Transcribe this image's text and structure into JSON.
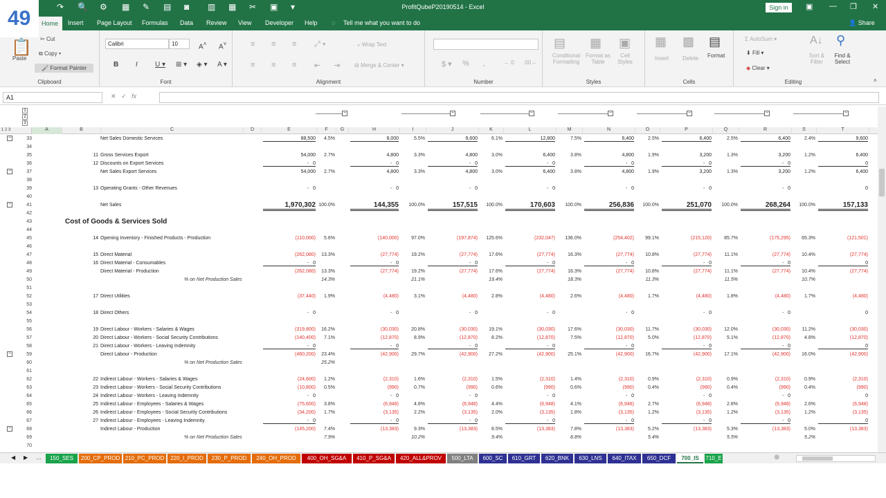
{
  "badge": "49",
  "app": {
    "title": "ProfitQubeP20190514  -  Excel",
    "signin": "Sign in"
  },
  "tabs": [
    {
      "label": "Home"
    },
    {
      "label": "Insert"
    },
    {
      "label": "Page Layout"
    },
    {
      "label": "Formulas"
    },
    {
      "label": "Data"
    },
    {
      "label": "Review"
    },
    {
      "label": "View"
    },
    {
      "label": "Developer"
    },
    {
      "label": "Help"
    },
    {
      "label": "Tell me what you want to do"
    }
  ],
  "share": "Share",
  "ribbon": {
    "clipboard": {
      "paste": "Paste",
      "cut": "Cut",
      "copy": "Copy",
      "painter": "Format Painter",
      "label": "Clipboard"
    },
    "font": {
      "name": "Calibri",
      "size": "10",
      "label": "Font"
    },
    "alignment": {
      "wrap": "Wrap Text",
      "merge": "Merge & Center",
      "label": "Alignment"
    },
    "number": {
      "label": "Number"
    },
    "styles": {
      "cond": "Conditional Formatting",
      "astable": "Format as Table",
      "cell": "Cell Styles",
      "label": "Styles"
    },
    "cells": {
      "insert": "Insert",
      "delete": "Delete",
      "format": "Format",
      "label": "Cells"
    },
    "editing": {
      "autosum": "AutoSum",
      "fill": "Fill",
      "clear": "Clear",
      "sort": "Sort & Filter",
      "find": "Find & Select",
      "label": "Editing"
    }
  },
  "namebox": "A1",
  "fx": "fx",
  "columns": [
    "A",
    "B",
    "C",
    "D",
    "E",
    "F",
    "G",
    "H",
    "I",
    "J",
    "K",
    "L",
    "M",
    "N",
    "O",
    "P",
    "Q",
    "R",
    "S",
    "T"
  ],
  "rows": [
    {
      "n": "33",
      "label": "Net Sales Domestic Services",
      "v": [
        "88,500",
        "8,000",
        "9,600",
        "12,800",
        "6,400",
        "6,400",
        "6,400",
        "9,600"
      ],
      "p": [
        "4.5%",
        "5.5%",
        "6.1%",
        "7.5%",
        "2.5%",
        "2.5%",
        "2.4%"
      ],
      "ul": true
    },
    {
      "n": "34"
    },
    {
      "n": "35",
      "num": "11",
      "label": "Gross Services Export",
      "v": [
        "54,000",
        "4,800",
        "4,800",
        "6,400",
        "4,800",
        "3,200",
        "3,200",
        "6,400"
      ],
      "p": [
        "2.7%",
        "3.3%",
        "3.0%",
        "3.8%",
        "1.9%",
        "1.3%",
        "1.2%"
      ]
    },
    {
      "n": "36",
      "num": "12",
      "label": "Discounts on Export Services",
      "v": [
        "0",
        "0",
        "0",
        "0",
        "0",
        "0",
        "0",
        "0"
      ],
      "p": [
        "-",
        "-",
        "-",
        "-",
        "-",
        "-",
        "-"
      ],
      "ul": true
    },
    {
      "n": "37",
      "label": "Net Sales Export Services",
      "v": [
        "54,000",
        "4,800",
        "4,800",
        "6,400",
        "4,800",
        "3,200",
        "3,200",
        "6,400"
      ],
      "p": [
        "2.7%",
        "3.3%",
        "3.0%",
        "3.8%",
        "1.9%",
        "1.3%",
        "1.2%"
      ]
    },
    {
      "n": "38"
    },
    {
      "n": "39",
      "num": "13",
      "label": "Operating Grants - Other Revenues",
      "v": [
        "0",
        "0",
        "0",
        "0",
        "0",
        "0",
        "0",
        "0"
      ],
      "p": [
        "-",
        "-",
        "-",
        "-",
        "-",
        "-",
        "-"
      ]
    },
    {
      "n": "40"
    },
    {
      "n": "41",
      "label": "Net Sales",
      "v": [
        "1,970,302",
        "144,355",
        "157,515",
        "170,603",
        "256,836",
        "251,070",
        "268,264",
        "157,133"
      ],
      "p": [
        "100.0%",
        "100.0%",
        "100.0%",
        "100.0%",
        "100.0%",
        "100.0%",
        "100.0%"
      ],
      "total": true
    },
    {
      "n": "42"
    },
    {
      "n": "43",
      "section": "Cost of Goods & Services Sold"
    },
    {
      "n": "44"
    },
    {
      "n": "45",
      "num": "14",
      "label": "Opening Inventory - Finished Products - Production",
      "v": [
        "(110,000)",
        "(140,000)",
        "(197,874)",
        "(232,047)",
        "(254,402)",
        "(215,120)",
        "(175,295)",
        "(121,501)"
      ],
      "p": [
        "5.6%",
        "97.0%",
        "125.6%",
        "136.0%",
        "99.1%",
        "85.7%",
        "65.3%"
      ],
      "neg": true
    },
    {
      "n": "46"
    },
    {
      "n": "47",
      "num": "15",
      "label": "Direct Material",
      "v": [
        "(262,080)",
        "(27,774)",
        "(27,774)",
        "(27,774)",
        "(27,774)",
        "(27,774)",
        "(27,774)",
        "(27,774)"
      ],
      "p": [
        "13.3%",
        "19.2%",
        "17.6%",
        "16.3%",
        "10.8%",
        "11.1%",
        "10.4%"
      ],
      "neg": true
    },
    {
      "n": "48",
      "num": "16",
      "label": "Direct Material - Consumables",
      "v": [
        "0",
        "0",
        "0",
        "0",
        "0",
        "0",
        "0",
        "0"
      ],
      "p": [
        "-",
        "-",
        "-",
        "-",
        "-",
        "-",
        "-"
      ],
      "neg": true,
      "ul": true
    },
    {
      "n": "49",
      "label": "Direct Material - Production",
      "v": [
        "(262,080)",
        "(27,774)",
        "(27,774)",
        "(27,774)",
        "(27,774)",
        "(27,774)",
        "(27,774)",
        "(27,774)"
      ],
      "p": [
        "13.3%",
        "19.2%",
        "17.6%",
        "16.3%",
        "10.8%",
        "11.1%",
        "10.4%"
      ],
      "neg": true
    },
    {
      "n": "50",
      "note": "% on Net Production Sales",
      "ip": [
        "14.3%",
        "21.1%",
        "19.4%",
        "18.3%",
        "11.3%",
        "11.5%",
        "10.7%"
      ]
    },
    {
      "n": "51"
    },
    {
      "n": "52",
      "num": "17",
      "label": "Direct Utilities",
      "v": [
        "(37,440)",
        "(4,480)",
        "(4,480)",
        "(4,480)",
        "(4,480)",
        "(4,480)",
        "(4,480)",
        "(4,480)"
      ],
      "p": [
        "1.9%",
        "3.1%",
        "2.8%",
        "2.6%",
        "1.7%",
        "1.8%",
        "1.7%"
      ],
      "neg": true
    },
    {
      "n": "53"
    },
    {
      "n": "54",
      "num": "18",
      "label": "Direct Others",
      "v": [
        "0",
        "0",
        "0",
        "0",
        "0",
        "0",
        "0",
        "0"
      ],
      "p": [
        "-",
        "-",
        "-",
        "-",
        "-",
        "-",
        "-"
      ],
      "neg": true
    },
    {
      "n": "55"
    },
    {
      "n": "56",
      "num": "19",
      "label": "Direct Labour - Workers - Salaries & Wages",
      "v": [
        "(319,800)",
        "(30,030)",
        "(30,030)",
        "(30,030)",
        "(30,030)",
        "(30,030)",
        "(30,030)",
        "(30,030)"
      ],
      "p": [
        "16.2%",
        "20.8%",
        "19.1%",
        "17.6%",
        "11.7%",
        "12.0%",
        "11.2%"
      ],
      "neg": true
    },
    {
      "n": "57",
      "num": "20",
      "label": "Direct Labour - Workers - Social Security Contributions",
      "v": [
        "(140,400)",
        "(12,870)",
        "(12,870)",
        "(12,870)",
        "(12,870)",
        "(12,870)",
        "(12,870)",
        "(12,870)"
      ],
      "p": [
        "7.1%",
        "8.9%",
        "8.2%",
        "7.5%",
        "5.0%",
        "5.1%",
        "4.8%"
      ],
      "neg": true
    },
    {
      "n": "58",
      "num": "21",
      "label": "Direct Labour - Workers - Leaving Indemnity",
      "v": [
        "0",
        "0",
        "0",
        "0",
        "0",
        "0",
        "0",
        "0"
      ],
      "p": [
        "-",
        "-",
        "-",
        "-",
        "-",
        "-",
        "-"
      ],
      "neg": true,
      "ul": true
    },
    {
      "n": "59",
      "label": "Direct Labour - Production",
      "v": [
        "(460,200)",
        "(42,900)",
        "(42,900)",
        "(42,900)",
        "(42,900)",
        "(42,900)",
        "(42,900)",
        "(42,900)"
      ],
      "p": [
        "23.4%",
        "29.7%",
        "27.2%",
        "25.1%",
        "16.7%",
        "17.1%",
        "16.0%"
      ],
      "neg": true
    },
    {
      "n": "60",
      "note": "% on Net Production Sales",
      "ip": [
        "25.2%",
        "",
        "",
        "",
        "",
        "",
        ""
      ]
    },
    {
      "n": "61"
    },
    {
      "n": "62",
      "num": "22",
      "label": "Indirect Labour - Workers - Salaries & Wages",
      "v": [
        "(24,600)",
        "(2,310)",
        "(2,310)",
        "(2,310)",
        "(2,310)",
        "(2,310)",
        "(2,310)",
        "(2,310)"
      ],
      "p": [
        "1.2%",
        "1.6%",
        "1.5%",
        "1.4%",
        "0.9%",
        "0.9%",
        "0.9%"
      ],
      "neg": true
    },
    {
      "n": "63",
      "num": "23",
      "label": "Indirect Labour - Workers - Social Security Contributions",
      "v": [
        "(10,800)",
        "(990)",
        "(990)",
        "(990)",
        "(990)",
        "(990)",
        "(990)",
        "(990)"
      ],
      "p": [
        "0.5%",
        "0.7%",
        "0.6%",
        "0.6%",
        "0.4%",
        "0.4%",
        "0.4%"
      ],
      "neg": true
    },
    {
      "n": "64",
      "num": "24",
      "label": "Indirect Labour - Workers - Leaving Indemnity",
      "v": [
        "0",
        "0",
        "0",
        "0",
        "0",
        "0",
        "0",
        "0"
      ],
      "p": [
        "-",
        "-",
        "-",
        "-",
        "-",
        "-",
        "-"
      ],
      "neg": true
    },
    {
      "n": "65",
      "num": "25",
      "label": "Indirect Labour - Employees - Salaries & Wages",
      "v": [
        "(75,600)",
        "(6,948)",
        "(6,948)",
        "(6,948)",
        "(6,948)",
        "(6,948)",
        "(6,948)",
        "(6,948)"
      ],
      "p": [
        "3.8%",
        "4.8%",
        "4.4%",
        "4.1%",
        "2.7%",
        "2.8%",
        "2.6%"
      ],
      "neg": true
    },
    {
      "n": "66",
      "num": "26",
      "label": "Indirect Labour - Employees - Social Security Contributions",
      "v": [
        "(34,200)",
        "(3,135)",
        "(3,135)",
        "(3,135)",
        "(3,135)",
        "(3,135)",
        "(3,135)",
        "(3,135)"
      ],
      "p": [
        "1.7%",
        "2.2%",
        "2.0%",
        "1.8%",
        "1.2%",
        "1.2%",
        "1.2%"
      ],
      "neg": true
    },
    {
      "n": "67",
      "num": "27",
      "label": "Indirect Labour - Employees - Leaving Indemnity",
      "v": [
        "0",
        "0",
        "0",
        "0",
        "0",
        "0",
        "0",
        "0"
      ],
      "p": [
        "-",
        "-",
        "-",
        "-",
        "-",
        "-",
        "-"
      ],
      "neg": true,
      "ul": true
    },
    {
      "n": "68",
      "label": "Indirect Labour - Production",
      "v": [
        "(145,200)",
        "(13,383)",
        "(13,383)",
        "(13,383)",
        "(13,383)",
        "(13,383)",
        "(13,383)",
        "(13,383)"
      ],
      "p": [
        "7.4%",
        "9.3%",
        "8.5%",
        "7.8%",
        "5.2%",
        "5.3%",
        "5.0%"
      ],
      "neg": true
    },
    {
      "n": "69",
      "note": "% on Net Production Sales",
      "ip": [
        "7.9%",
        "10.2%",
        "9.4%",
        "8.8%",
        "5.4%",
        "5.5%",
        "5.2%"
      ]
    },
    {
      "n": "70"
    }
  ],
  "sheets": [
    {
      "label": "150_SES",
      "color": "#1aa34a"
    },
    {
      "label": "200_CP_PROD",
      "color": "#e46c0a"
    },
    {
      "label": "210_PC_PROD",
      "color": "#e46c0a"
    },
    {
      "label": "220_I_PROD",
      "color": "#e46c0a"
    },
    {
      "label": "230_P_PROD",
      "color": "#e46c0a"
    },
    {
      "label": "240_OH_PROD",
      "color": "#e46c0a"
    },
    {
      "label": "400_OH_SG&A",
      "color": "#c00000"
    },
    {
      "label": "410_P_SG&A",
      "color": "#c00000"
    },
    {
      "label": "420_ALL&PROV",
      "color": "#c00000"
    },
    {
      "label": "500_LTA",
      "color": "#808080"
    },
    {
      "label": "600_SC",
      "color": "#2e3192"
    },
    {
      "label": "610_GRT",
      "color": "#2e3192"
    },
    {
      "label": "620_BNK",
      "color": "#2e3192"
    },
    {
      "label": "630_LNS",
      "color": "#2e3192"
    },
    {
      "label": "640_ITAX",
      "color": "#2e3192"
    },
    {
      "label": "650_DCF",
      "color": "#2e3192"
    },
    {
      "label": "700_IS",
      "color": "#ffffff"
    },
    {
      "label": "710_E",
      "color": "#1aa34a"
    }
  ]
}
